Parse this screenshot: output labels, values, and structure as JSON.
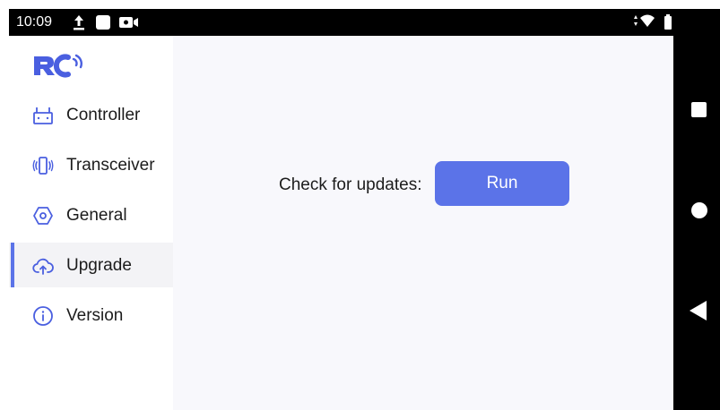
{
  "status_bar": {
    "time": "10:09",
    "icons": [
      "upload-icon",
      "square-notification-icon",
      "video-camera-icon",
      "data-arrows-icon",
      "wifi-icon",
      "battery-icon"
    ]
  },
  "nav_bar": {
    "buttons": [
      "recents-button",
      "home-button",
      "back-button"
    ]
  },
  "sidebar": {
    "logo_icon": "rc-logo-icon",
    "items": [
      {
        "label": "Controller",
        "icon": "controller-icon",
        "active": false
      },
      {
        "label": "Transceiver",
        "icon": "transceiver-icon",
        "active": false
      },
      {
        "label": "General",
        "icon": "hexagon-gear-icon",
        "active": false
      },
      {
        "label": "Upgrade",
        "icon": "cloud-upload-icon",
        "active": true
      },
      {
        "label": "Version",
        "icon": "info-icon",
        "active": false
      }
    ]
  },
  "main": {
    "update_label": "Check for updates:",
    "run_button_label": "Run"
  },
  "colors": {
    "accent": "#5b73e8",
    "active_item_bg": "#f3f3f6",
    "content_bg": "#f8f8fc",
    "text": "#1c1c1c",
    "system_bar": "#000000"
  }
}
